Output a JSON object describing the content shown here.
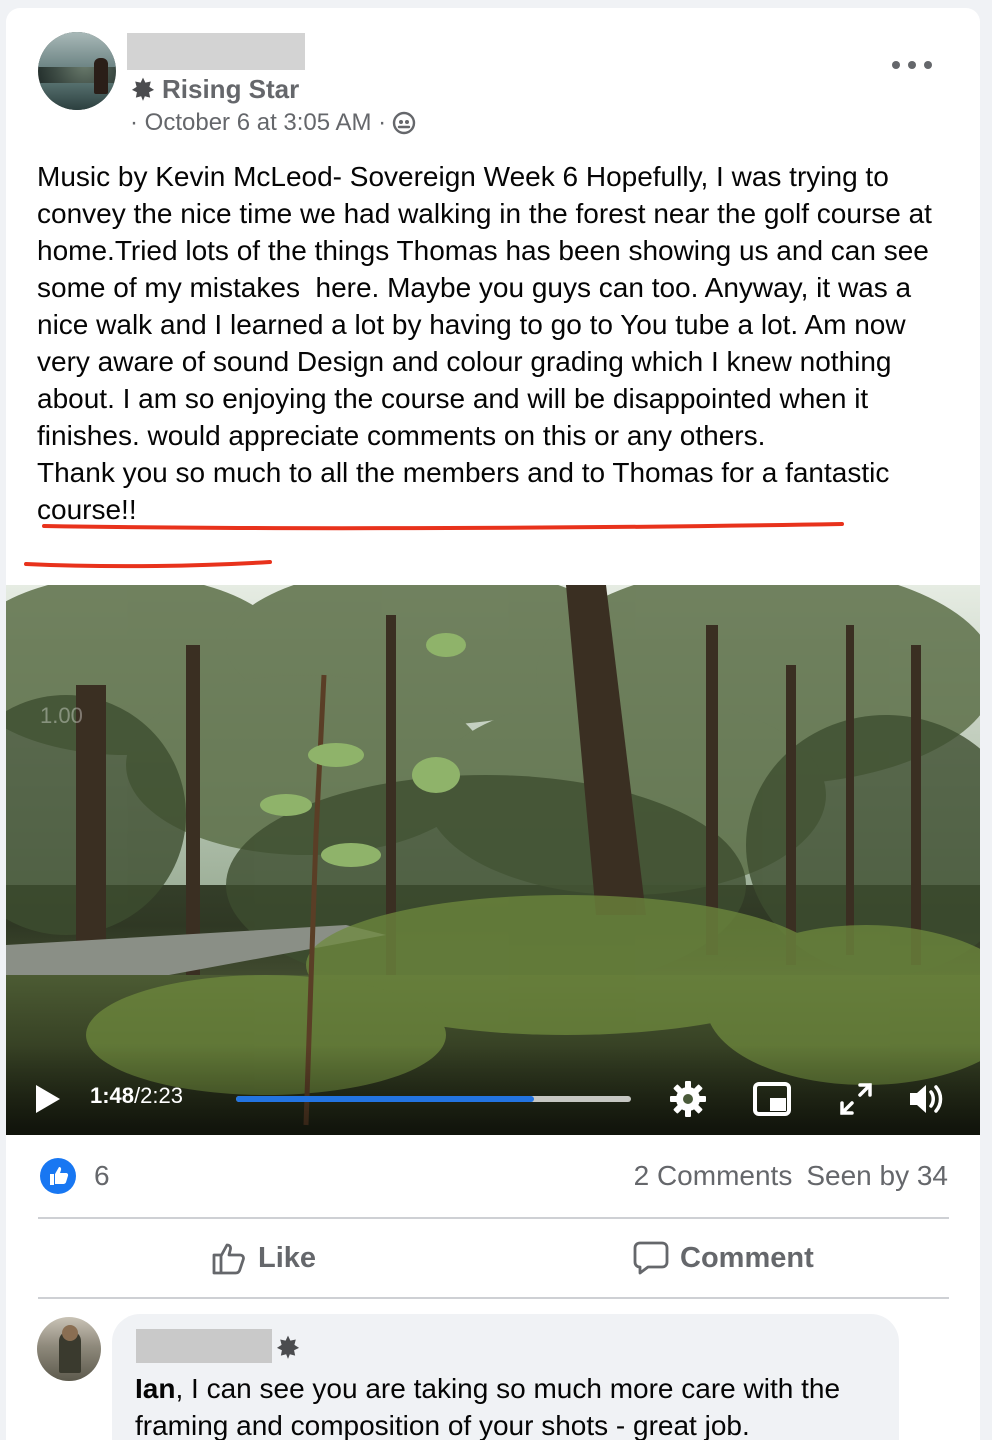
{
  "post": {
    "badge_label": "Rising Star",
    "meta": "· October 6 at 3:05 AM ·",
    "text_main": "Music by Kevin McLeod- Sovereign Week 6 Hopefully, I was trying to convey the nice time we had walking in the forest near the golf course at home.Tried lots of the things Thomas has been showing us and can see some of my mistakes  here. Maybe you guys can too. Anyway, it was a nice walk and I learned a lot by having to go to You tube a lot. Am now very aware of sound Design and colour grading which I knew nothing about. I am so enjoying the course and will be disappointed when it finishes. would appreciate comments on this or any others.",
    "text_highlight": "Thank you so much to all the members and to Thomas for a fantastic course!!",
    "underline_color": "#e8321c"
  },
  "video": {
    "watermark": "1.00",
    "current_time": "1:48",
    "separator": " / ",
    "duration": "2:23",
    "progress_fraction": 0.755,
    "progress_color": "#2374e1"
  },
  "stats": {
    "likes": "6",
    "comments": "2 Comments",
    "seen_by": "Seen by 34"
  },
  "actions": {
    "like_label": "Like",
    "comment_label": "Comment"
  },
  "comment": {
    "mention": "Ian",
    "text": ", I can see you are taking so much more care with the framing and composition of your shots - great job."
  },
  "icons": [
    "star-icon",
    "globe-icon",
    "more-icon",
    "play-icon",
    "settings-icon",
    "pip-icon",
    "fullscreen-icon",
    "volume-icon",
    "like-reaction-icon",
    "thumbs-up-icon",
    "comment-icon"
  ]
}
